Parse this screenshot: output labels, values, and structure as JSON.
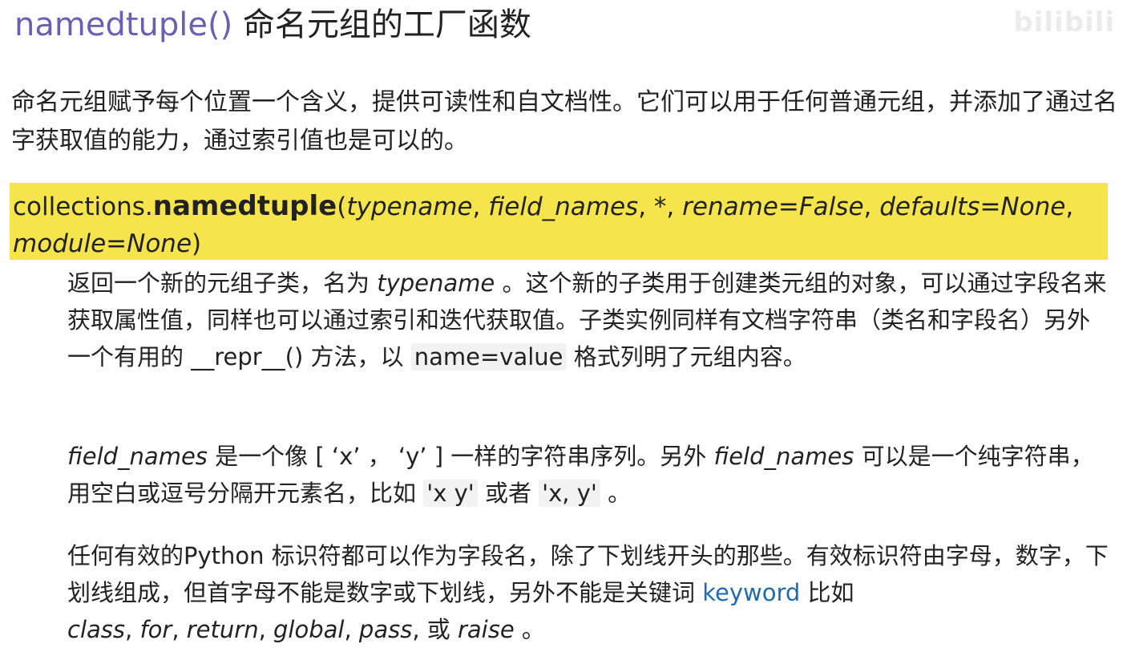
{
  "header": {
    "function_name": "namedtuple()",
    "title_zh": "命名元组的工厂函数",
    "watermark": "bilibili"
  },
  "intro": "命名元组赋予每个位置一个含义，提供可读性和自文档性。它们可以用于任何普通元组，并添加了通过名字获取值的能力，通过索引值也是可以的。",
  "signature": {
    "module": "collections.",
    "name": "namedtuple",
    "open_paren": "(",
    "params": [
      "typename",
      "field_names",
      "*",
      "rename=False",
      "defaults=None",
      "module=None"
    ],
    "close_paren": ")"
  },
  "para1": {
    "t1": "返回一个新的元组子类，名为 ",
    "typename": "typename",
    "t2": " 。这个新的子类用于创建类元组的对象，可以通过字段名来获取属性值，同样也可以通过索引和迭代获取值。子类实例同样有文档字符串（类名和字段名）另外一个有用的 ",
    "repr": "__repr__()",
    "t3": " 方法，以 ",
    "code": "name=value",
    "t4": " 格式列明了元组内容。"
  },
  "para2": {
    "field1": "field_names",
    "t1": " 是一个像 [ ‘x’ ， ‘y’ ] 一样的字符串序列。另外 ",
    "field2": "field_names",
    "t2": " 可以是一个纯字符串，用空白或逗号分隔开元素名，比如 ",
    "code1": "'x y'",
    "t3": " 或者 ",
    "code2": "'x, y'",
    "t4": " 。"
  },
  "para3": {
    "t1": "任何有效的Python 标识符都可以作为字段名，除了下划线开头的那些。有效标识符由字母，数字，下划线组成，但首字母不能是数字或下划线，另外不能是关键词 ",
    "keyword": "keyword",
    "t2": " 比如 ",
    "kw": [
      "class",
      "for",
      "return",
      "global",
      "pass"
    ],
    "sep": ", ",
    "or": ", 或 ",
    "last": "raise",
    "end": " 。"
  },
  "colors": {
    "function_name": "#6a5fb0",
    "highlight": "#f5e44c",
    "link": "#1f6bb0",
    "code_bg": "#f2f2f2"
  }
}
